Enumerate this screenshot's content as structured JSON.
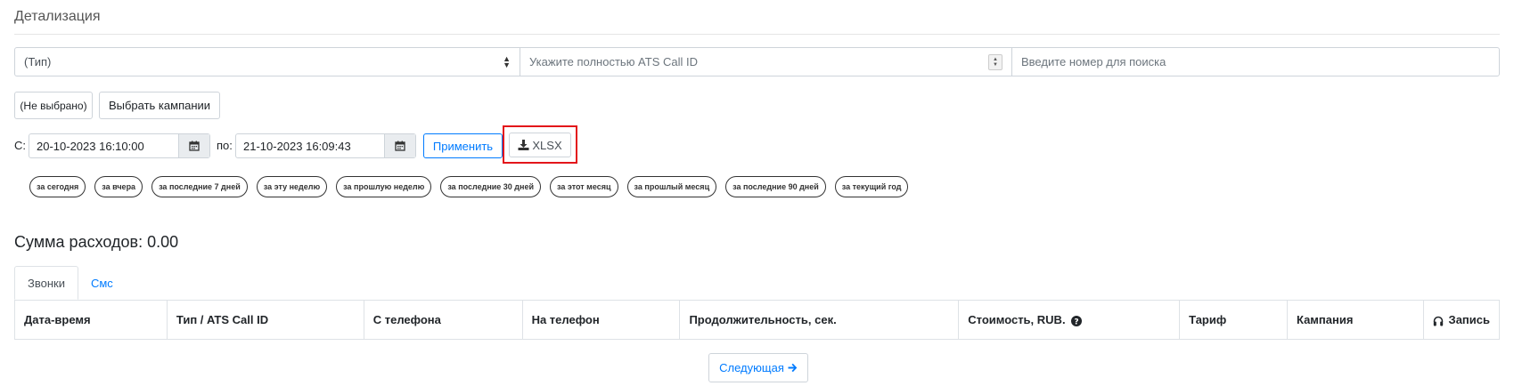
{
  "page": {
    "title": "Детализация"
  },
  "filters": {
    "type_select_value": "(Тип)",
    "callid_placeholder": "Укажите полностью ATS Call ID",
    "number_placeholder": "Введите номер для поиска"
  },
  "campaign": {
    "selected_label": "(Не выбрано)",
    "choose_button": "Выбрать кампании"
  },
  "dates": {
    "from_label": "С:",
    "from_value": "20-10-2023 16:10:00",
    "to_label": "по:",
    "to_value": "21-10-2023 16:09:43",
    "apply_button": "Применить",
    "xlsx_button": "XLSX"
  },
  "quick_ranges": [
    "за сегодня",
    "за вчера",
    "за последние 7 дней",
    "за эту неделю",
    "за прошлую неделю",
    "за последние 30 дней",
    "за этот месяц",
    "за прошлый месяц",
    "за последние 90 дней",
    "за текущий год"
  ],
  "summary": {
    "text": "Сумма расходов: 0.00"
  },
  "tabs": [
    {
      "label": "Звонки",
      "active": true
    },
    {
      "label": "Смс",
      "active": false
    }
  ],
  "table": {
    "columns": [
      "Дата-время",
      "Тип / ATS Call ID",
      "С телефона",
      "На телефон",
      "Продолжительность, сек.",
      "Стоимость, RUB.",
      "Тариф",
      "Кампания",
      "Запись"
    ]
  },
  "pagination": {
    "next_button": "Следующая"
  },
  "colors": {
    "accent": "#007bff",
    "highlight": "#e3151a"
  },
  "icons": {
    "calendar": "calendar-icon",
    "download": "download-icon",
    "question": "question-circle-icon",
    "headphones": "headphones-icon",
    "arrow_right": "arrow-right-icon"
  }
}
